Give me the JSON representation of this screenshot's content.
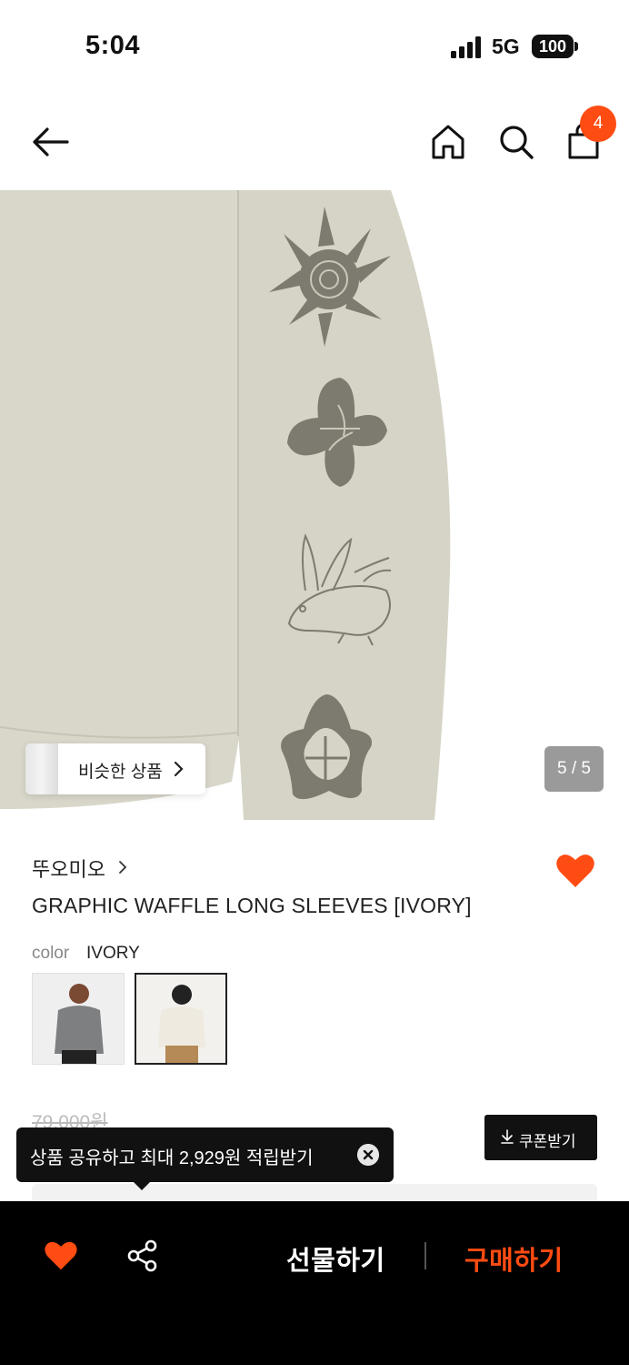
{
  "status_bar": {
    "time": "5:04",
    "network": "5G",
    "battery": "100"
  },
  "nav": {
    "back_icon": "arrow-left-icon",
    "home_icon": "home-icon",
    "search_icon": "search-icon",
    "cart_icon": "shopping-bag-icon",
    "cart_count": "4"
  },
  "gallery": {
    "similar_label": "비슷한 상품",
    "page_counter": "5 / 5"
  },
  "product": {
    "brand": "뚜오미오",
    "title": "GRAPHIC WAFFLE LONG SLEEVES [IVORY]",
    "option_label": "color",
    "option_value": "IVORY",
    "liked": true,
    "original_price": "79,000원"
  },
  "coupon": {
    "label": "쿠폰받기",
    "icon": "download-icon"
  },
  "tooltip": {
    "text": "상품 공유하고 최대 2,929원 적립받기",
    "close_icon": "close-circle-icon"
  },
  "bottom_bar": {
    "like_icon": "heart-icon",
    "share_icon": "share-icon",
    "gift_label": "선물하기",
    "buy_label": "구매하기"
  },
  "colors": {
    "accent": "#ff4c12",
    "sweater": "#d9d7ca",
    "print": "#7d7b70"
  }
}
